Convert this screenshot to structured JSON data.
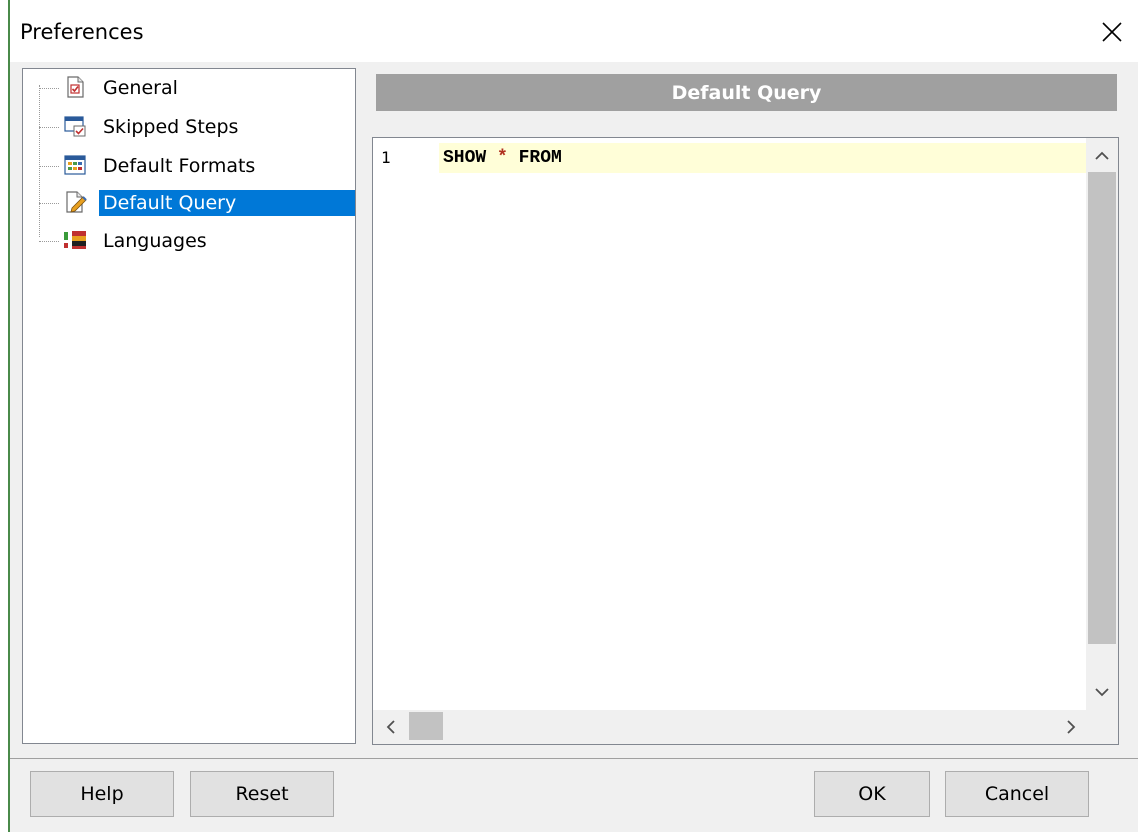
{
  "window": {
    "title": "Preferences"
  },
  "tree": {
    "items": [
      {
        "label": "General",
        "icon": "general-page-icon",
        "selected": false
      },
      {
        "label": "Skipped Steps",
        "icon": "skipped-steps-icon",
        "selected": false
      },
      {
        "label": "Default Formats",
        "icon": "grid-formats-icon",
        "selected": false
      },
      {
        "label": "Default Query",
        "icon": "edit-query-icon",
        "selected": true
      },
      {
        "label": "Languages",
        "icon": "flags-languages-icon",
        "selected": false
      }
    ]
  },
  "panel": {
    "header": "Default Query"
  },
  "editor": {
    "line_number": "1",
    "code_part1": "SHOW ",
    "code_star": "*",
    "code_part2": " FROM"
  },
  "buttons": {
    "help": "Help",
    "reset": "Reset",
    "ok": "OK",
    "cancel": "Cancel"
  },
  "colors": {
    "selection": "#0078d7",
    "header_bar": "#a0a0a0",
    "current_line": "#fffed8"
  }
}
